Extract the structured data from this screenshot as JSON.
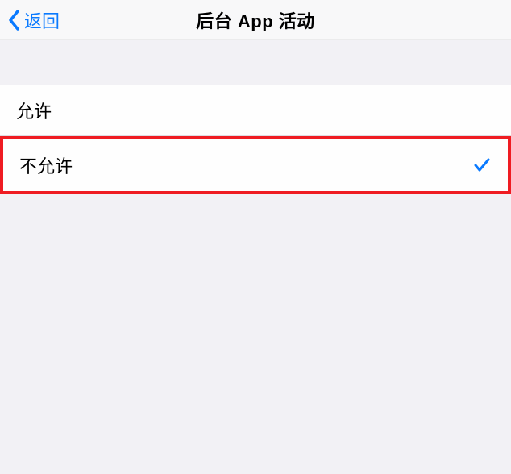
{
  "navbar": {
    "back_label": "返回",
    "title": "后台 App 活动"
  },
  "options": {
    "allow_label": "允许",
    "deny_label": "不允许",
    "selected": "deny"
  }
}
